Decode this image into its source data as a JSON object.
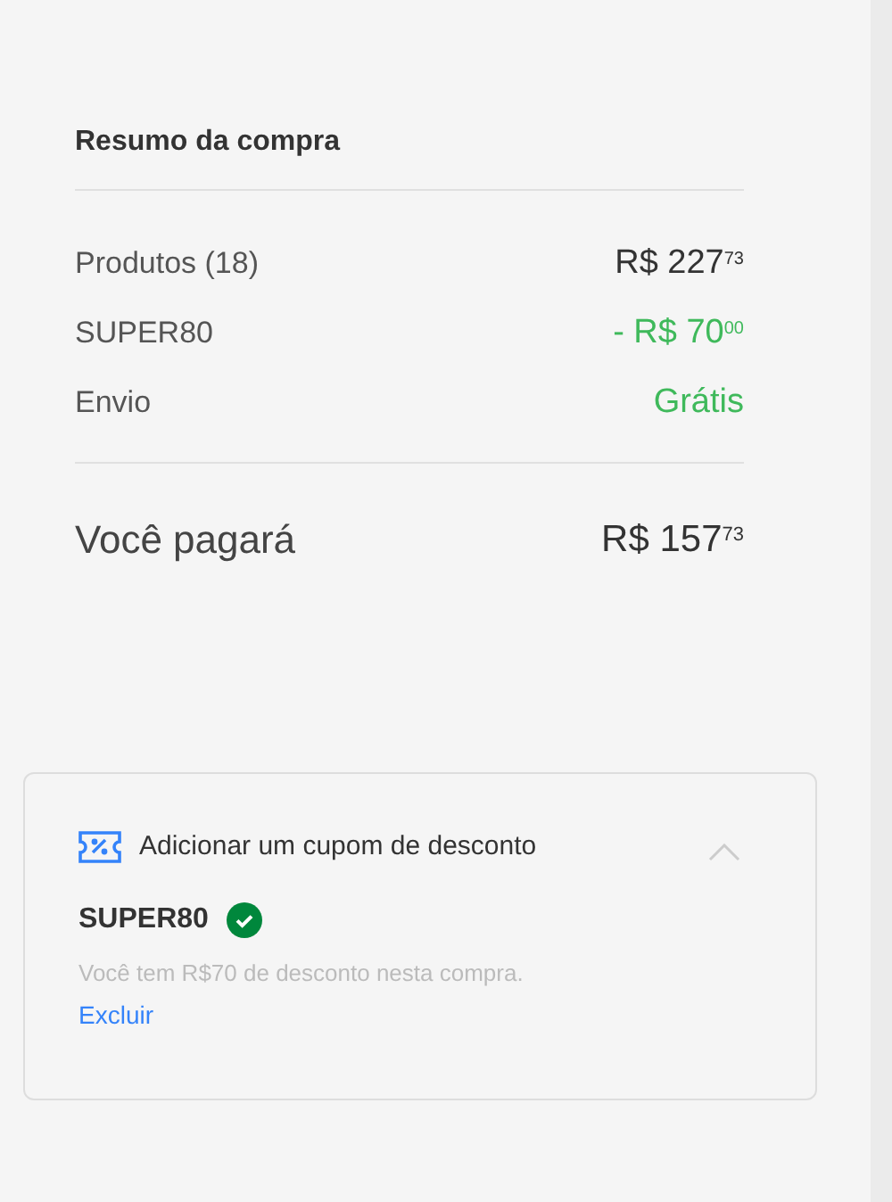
{
  "summary": {
    "title": "Resumo da compra",
    "rows": [
      {
        "label": "Produtos (18)",
        "value": "R$ 227$^{73}$",
        "kind": "default"
      },
      {
        "label": "SUPER80",
        "value": "- R$ 70$^{00}$",
        "kind": "discount"
      },
      {
        "label": "Envio",
        "value": "Grátis",
        "kind": "discount"
      }
    ],
    "total": {
      "label": "Você pagará",
      "value": "R$ 157$^{73}$"
    }
  },
  "coupon": {
    "title": "Adicionar um cupom de desconto",
    "expanded": true,
    "code": "SUPER80",
    "applied": true,
    "message": "Você tem R$70 de desconto nesta compra.",
    "remove_link": "Excluir"
  }
}
